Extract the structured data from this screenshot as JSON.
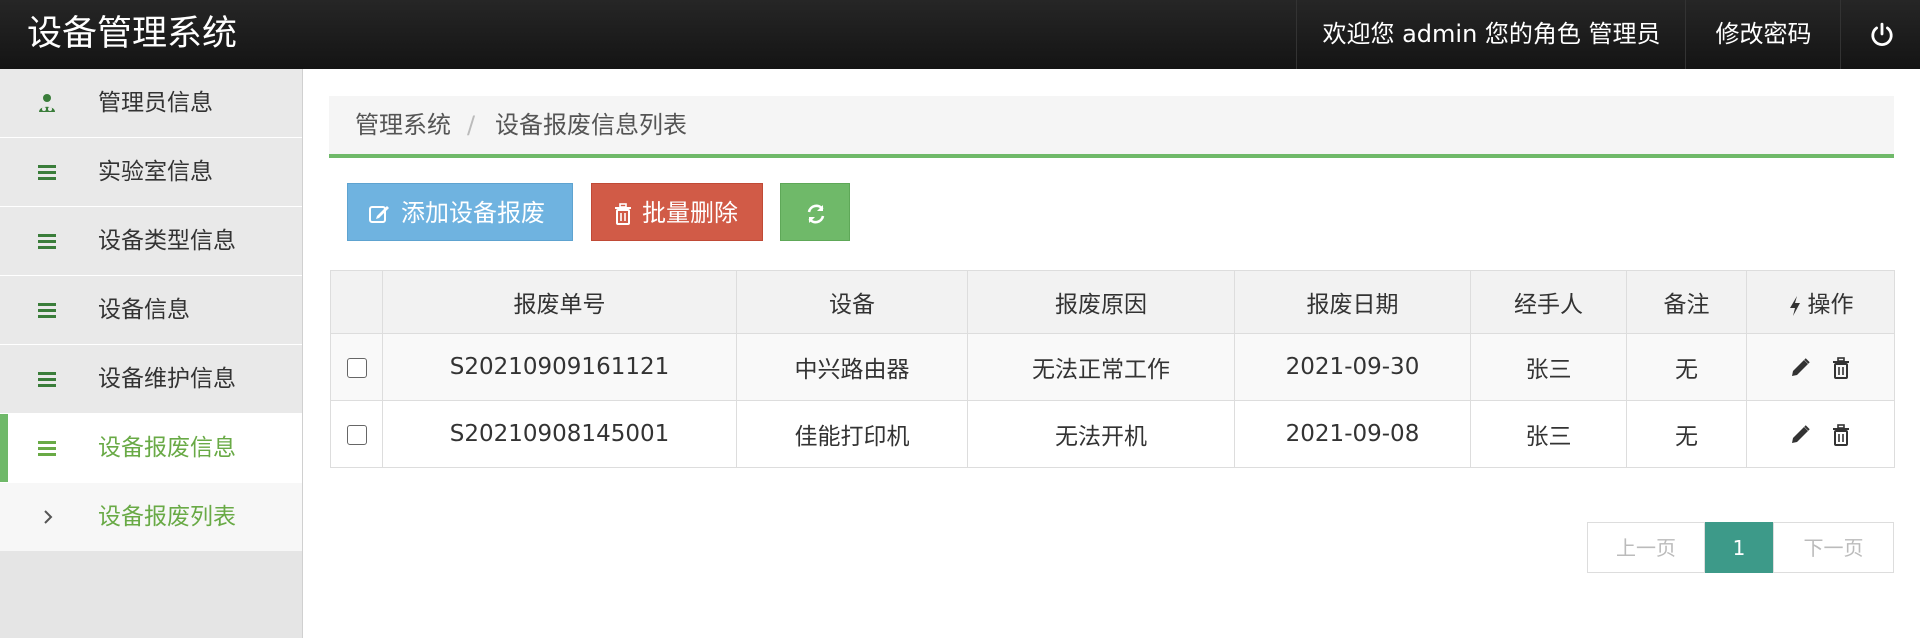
{
  "header": {
    "brand": "设备管理系统",
    "welcome": "欢迎您 admin 您的角色 管理员",
    "change_password": "修改密码",
    "logout_icon": "power-icon"
  },
  "sidebar": {
    "items": [
      {
        "label": "管理员信息",
        "icon": "admin-user-icon"
      },
      {
        "label": "实验室信息",
        "icon": "list-icon"
      },
      {
        "label": "设备类型信息",
        "icon": "list-icon"
      },
      {
        "label": "设备信息",
        "icon": "list-icon"
      },
      {
        "label": "设备维护信息",
        "icon": "list-icon"
      },
      {
        "label": "设备报废信息",
        "icon": "list-icon",
        "active": true
      }
    ],
    "submenu": [
      {
        "label": "设备报废列表",
        "icon": "chevron-right-icon"
      }
    ]
  },
  "breadcrumb": {
    "root": "管理系统",
    "separator": "/",
    "current": "设备报废信息列表"
  },
  "toolbar": {
    "add_label": "添加设备报废",
    "batch_delete_label": "批量删除",
    "refresh_icon": "refresh-icon"
  },
  "table": {
    "columns": [
      "报废单号",
      "设备",
      "报废原因",
      "报废日期",
      "经手人",
      "备注",
      "操作"
    ],
    "rows": [
      {
        "id": "S20210909161121",
        "device": "中兴路由器",
        "reason": "无法正常工作",
        "date": "2021-09-30",
        "handler": "张三",
        "remark": "无"
      },
      {
        "id": "S20210908145001",
        "device": "佳能打印机",
        "reason": "无法开机",
        "date": "2021-09-08",
        "handler": "张三",
        "remark": "无"
      }
    ]
  },
  "pagination": {
    "prev": "上一页",
    "current": "1",
    "next": "下一页"
  },
  "colors": {
    "header_bg": "#1c1c1c",
    "accent_green": "#6fb969",
    "active_text": "#69aa46",
    "add_button": "#6fb3e0",
    "delete_button": "#d15b47",
    "page_active": "#3d9a89"
  }
}
